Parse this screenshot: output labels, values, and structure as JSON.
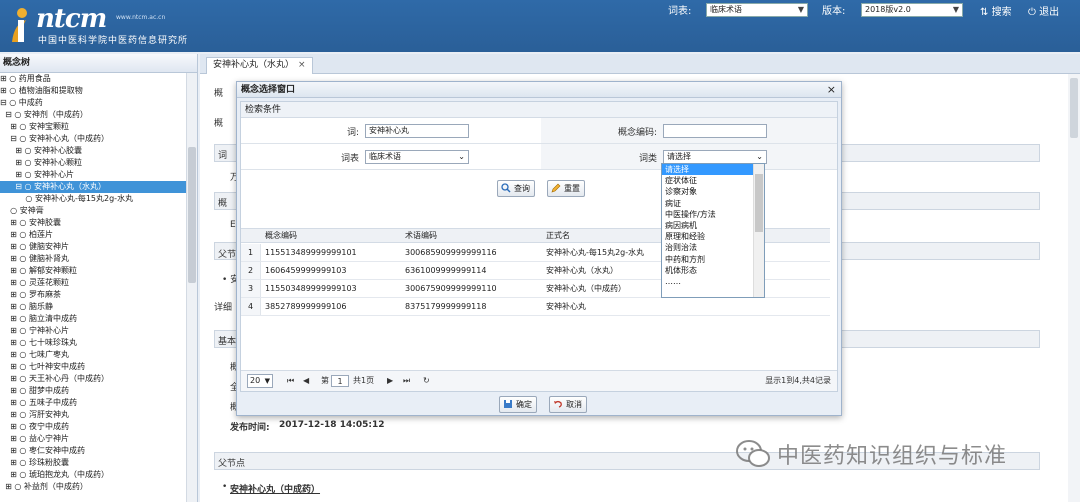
{
  "header": {
    "logo_text": "ntcm",
    "logo_url": "www.ntcm.ac.cn",
    "org_name": "中国中医科学院中医药信息研究所",
    "vocab_label": "词表:",
    "vocab_value": "临床术语",
    "version_label": "版本:",
    "version_value": "2018版v2.0",
    "search_label": "搜索",
    "logout_label": "退出"
  },
  "sidebar": {
    "title": "概念树",
    "items": [
      {
        "text": "⊞ ○ 药用食品"
      },
      {
        "text": "⊞ ○ 植物油脂和提取物"
      },
      {
        "text": "⊟ ○ 中成药"
      },
      {
        "text": "  ⊟ ○ 安神剂（中成药）"
      },
      {
        "text": "    ⊞ ○ 安神宝颗粒"
      },
      {
        "text": "    ⊟ ○ 安神补心丸（中成药）"
      },
      {
        "text": "      ⊞ ○ 安神补心胶囊"
      },
      {
        "text": "      ⊞ ○ 安神补心颗粒"
      },
      {
        "text": "      ⊞ ○ 安神补心片"
      },
      {
        "text": "      ⊟ ○ 安神补心丸（水丸）"
      },
      {
        "text": "          ○ 安神补心丸-每15丸2g-水丸"
      },
      {
        "text": "    ○ 安神膏"
      },
      {
        "text": "    ⊞ ○ 安神胶囊"
      },
      {
        "text": "    ⊞ ○ 柏莲片"
      },
      {
        "text": "    ⊞ ○ 健脑安神片"
      },
      {
        "text": "    ⊞ ○ 健脑补肾丸"
      },
      {
        "text": "    ⊞ ○ 解郁安神颗粒"
      },
      {
        "text": "    ⊞ ○ 灵莲花颗粒"
      },
      {
        "text": "    ⊞ ○ 罗布麻茶"
      },
      {
        "text": "    ⊞ ○ 脑乐静"
      },
      {
        "text": "    ⊞ ○ 脑立清中成药"
      },
      {
        "text": "    ⊞ ○ 宁神补心片"
      },
      {
        "text": "    ⊞ ○ 七十味珍珠丸"
      },
      {
        "text": "    ⊞ ○ 七味广枣丸"
      },
      {
        "text": "    ⊞ ○ 七叶神安中成药"
      },
      {
        "text": "    ⊞ ○ 天王补心丹（中成药）"
      },
      {
        "text": "    ⊞ ○ 甜梦中成药"
      },
      {
        "text": "    ⊞ ○ 五味子中成药"
      },
      {
        "text": "    ⊞ ○ 泻肝安神丸"
      },
      {
        "text": "    ⊞ ○ 夜宁中成药"
      },
      {
        "text": "    ⊞ ○ 益心宁神片"
      },
      {
        "text": "    ⊞ ○ 枣仁安神中成药"
      },
      {
        "text": "    ⊞ ○ 珍珠粉胶囊"
      },
      {
        "text": "    ⊞ ○ 琥珀抱龙丸（中成药）"
      },
      {
        "text": "  ⊞ ○ 补益剂（中成药）"
      }
    ],
    "selected_index": 9
  },
  "main": {
    "tab_label": "安神补心丸（水丸）",
    "tab_close": "×",
    "bg_labels": {
      "l1": "概",
      "l2": "概",
      "l3": "词",
      "l4": "万",
      "l5": "概",
      "l6": "E",
      "l7": "父节",
      "l8": "• 安",
      "l9": "详细",
      "l10": "基本",
      "l11": "概",
      "l12": "全",
      "l13": "概"
    },
    "publish_label": "发布时间:",
    "publish_value": "2017-12-18 14:05:12",
    "parent_node_label": "父节点",
    "parent_node_link": "安神补心丸（中成药）"
  },
  "modal": {
    "title": "概念选择窗口",
    "close": "×",
    "section_title": "检索条件",
    "term_label": "词:",
    "term_value": "安神补心丸",
    "code_label": "概念编码:",
    "code_value": "",
    "vocab_label": "词表",
    "vocab_value": "临床术语",
    "semantic_label": "词类",
    "semantic_value": "请选择",
    "query_button": "查询",
    "reset_button": "重置",
    "columns": [
      "概念编码",
      "术语编码",
      "正式名"
    ],
    "rows": [
      {
        "n": "1",
        "concept": "115513489999999101",
        "term": "300685909999999116",
        "name": "安神补心丸-每15丸2g-水丸"
      },
      {
        "n": "2",
        "concept": "1606459999999103",
        "term": "6361009999999114",
        "name": "安神补心丸（水丸）"
      },
      {
        "n": "3",
        "concept": "115503489999999103",
        "term": "300675909999999110",
        "name": "安神补心丸（中成药）"
      },
      {
        "n": "4",
        "concept": "3852789999999106",
        "term": "8375179999999118",
        "name": "安神补心丸"
      }
    ],
    "pager": {
      "page_size": "20",
      "page_prefix": "第",
      "page_value": "1",
      "page_total": "共1页",
      "summary": "显示1到4,共4记录"
    },
    "ok_button": "确定",
    "cancel_button": "取消"
  },
  "dropdown": {
    "options": [
      "请选择",
      "症状体征",
      "诊察对象",
      "病证",
      "中医操作/方法",
      "病因病机",
      "原理和经验",
      "治则治法",
      "中药和方剂",
      "机体形态",
      "……"
    ],
    "selected_index": 0
  },
  "watermark": {
    "text": "中医药知识组织与标准"
  },
  "colors": {
    "header_bg": "#2f6aa8",
    "selection": "#3f93d8",
    "dropdown_selection": "#3399ff"
  }
}
